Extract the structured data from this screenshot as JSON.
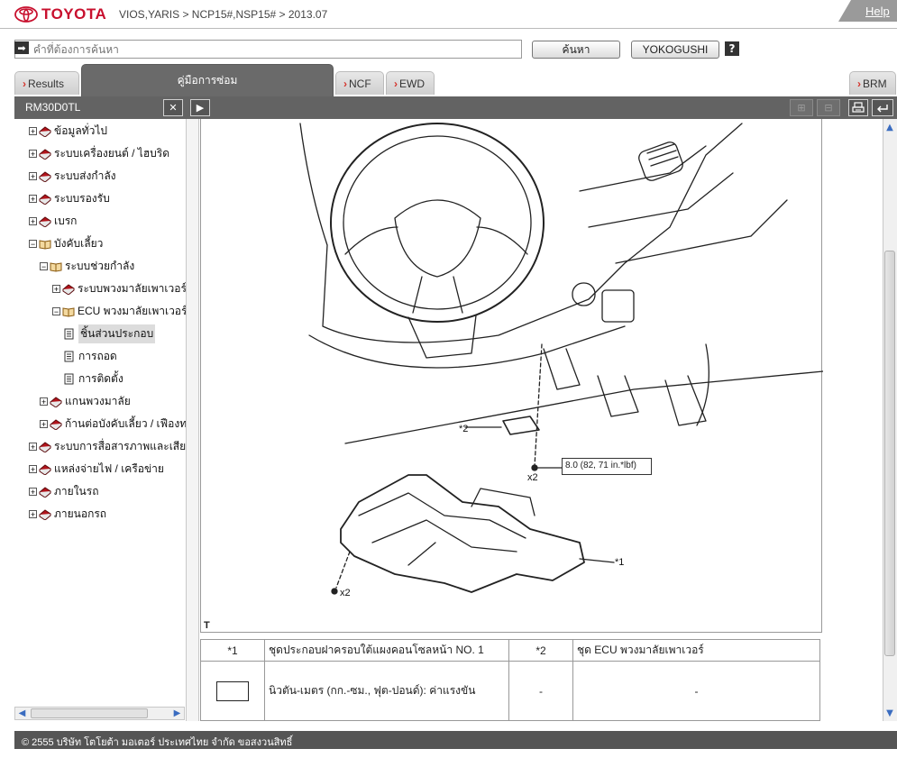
{
  "header": {
    "brand": "TOYOTA",
    "breadcrumb": "VIOS,YARIS > NCP15#,NSP15# > 2013.07",
    "help_link": "Help"
  },
  "search": {
    "placeholder": "คำที่ต้องการค้นหา",
    "search_button": "ค้นหา",
    "yokogushi_button": "YOKOGUSHI",
    "help_button": "?"
  },
  "tabs": {
    "results": "Results",
    "manual": "คู่มือการซ่อม",
    "ncf": "NCF",
    "ewd": "EWD",
    "brm": "BRM"
  },
  "toolbar": {
    "doc_id": "RM30D0TL",
    "close_glyph": "✕",
    "expand_glyph": "▶"
  },
  "tree": [
    {
      "label": "ข้อมูลทั่วไป",
      "level": 0,
      "toggle": "+",
      "icon": "book-closed"
    },
    {
      "label": "ระบบเครื่องยนต์ / ไฮบริด",
      "level": 0,
      "toggle": "+",
      "icon": "book-closed"
    },
    {
      "label": "ระบบส่งกำลัง",
      "level": 0,
      "toggle": "+",
      "icon": "book-closed"
    },
    {
      "label": "ระบบรองรับ",
      "level": 0,
      "toggle": "+",
      "icon": "book-closed"
    },
    {
      "label": "เบรก",
      "level": 0,
      "toggle": "+",
      "icon": "book-closed"
    },
    {
      "label": "บังคับเลี้ยว",
      "level": 0,
      "toggle": "−",
      "icon": "book-open"
    },
    {
      "label": "ระบบช่วยกำลัง",
      "level": 1,
      "toggle": "−",
      "icon": "book-open"
    },
    {
      "label": "ระบบพวงมาลัยเพาเวอร์",
      "level": 2,
      "toggle": "+",
      "icon": "book-closed"
    },
    {
      "label": "ECU พวงมาลัยเพาเวอร์",
      "level": 2,
      "toggle": "−",
      "icon": "book-open"
    },
    {
      "label": "ชิ้นส่วนประกอบ",
      "level": 3,
      "toggle": "",
      "icon": "page",
      "selected": true
    },
    {
      "label": "การถอด",
      "level": 3,
      "toggle": "",
      "icon": "page"
    },
    {
      "label": "การติดตั้ง",
      "level": 3,
      "toggle": "",
      "icon": "page"
    },
    {
      "label": "แกนพวงมาลัย",
      "level": 1,
      "toggle": "+",
      "icon": "book-closed"
    },
    {
      "label": "ก้านต่อบังคับเลี้ยว / เฟืองท",
      "level": 1,
      "toggle": "+",
      "icon": "book-closed"
    },
    {
      "label": "ระบบการสื่อสารภาพและเสียง",
      "level": 0,
      "toggle": "+",
      "icon": "book-closed"
    },
    {
      "label": "แหล่งจ่ายไฟ / เครือข่าย",
      "level": 0,
      "toggle": "+",
      "icon": "book-closed"
    },
    {
      "label": "ภายในรถ",
      "level": 0,
      "toggle": "+",
      "icon": "book-closed"
    },
    {
      "label": "ภายนอกรถ",
      "level": 0,
      "toggle": "+",
      "icon": "book-closed"
    }
  ],
  "illustration": {
    "callout_2": "*2",
    "callout_1": "*1",
    "x2_upper": "x2",
    "x2_lower": "x2",
    "torque": "8.0 (82, 71 in.*lbf)",
    "figure_label": "T"
  },
  "legend": {
    "row1": {
      "num1": "*1",
      "desc1": "ชุดประกอบฝาครอบใต้แผงคอนโซลหน้า NO. 1",
      "num2": "*2",
      "desc2": "ชุด ECU พวงมาลัยเพาเวอร์"
    },
    "row2": {
      "desc": "นิวตัน-เมตร (กก.-ซม., ฟุต-ปอนด์): ค่าแรงขัน",
      "dash1": "-",
      "dash2": "-"
    }
  },
  "footer": {
    "copyright": "© 2555 บริษัท โตโยต้า มอเตอร์ ประเทศไทย จำกัด ขอสงวนสิทธิ์"
  }
}
